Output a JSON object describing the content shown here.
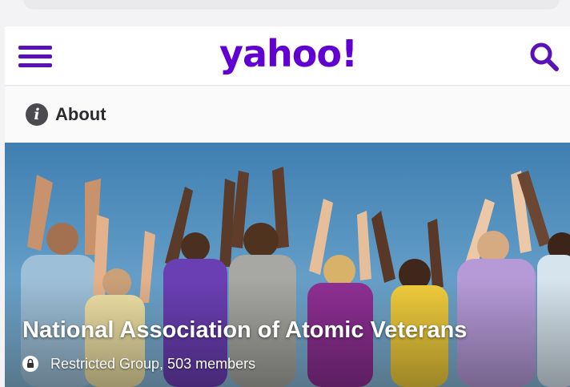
{
  "header": {
    "logo_text": "yahoo!",
    "menu_icon": "hamburger-menu-icon",
    "search_icon": "search-icon",
    "brand_color": "#6001d2"
  },
  "about": {
    "label": "About",
    "icon": "info-icon",
    "icon_glyph": "i"
  },
  "group": {
    "title": "National Association of Atomic Veterans",
    "meta": "Restricted Group, 503 members",
    "privacy_icon": "lock-icon"
  }
}
